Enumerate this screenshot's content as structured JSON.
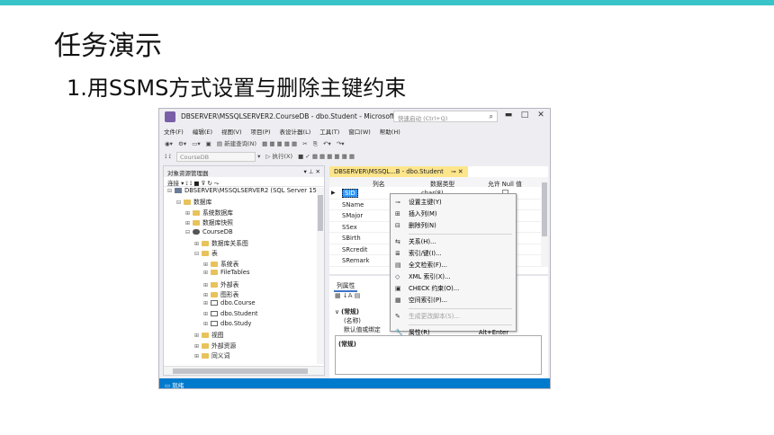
{
  "slide": {
    "title": "任务演示",
    "subtitle": "1.用SSMS方式设置与删除主键约束"
  },
  "window": {
    "title": "DBSERVER\\MSSQLSERVER2.CourseDB - dbo.Student - Microsoft SQL...",
    "quick_launch": "快速启动 (Ctrl+Q)"
  },
  "menu": [
    "文件(F)",
    "编辑(E)",
    "视图(V)",
    "项目(P)",
    "表设计器(L)",
    "工具(T)",
    "窗口(W)",
    "帮助(H)"
  ],
  "toolbar": {
    "new_query": "新建查询(N)",
    "database": "CourseDB",
    "execute": "执行(X)"
  },
  "object_explorer": {
    "title": "对象资源管理器",
    "connect": "连接",
    "tree": [
      {
        "label": "DBSERVER\\MSSQLSERVER2 (SQL Server 15",
        "level": 0,
        "icon": "server-icon",
        "exp": "⊟"
      },
      {
        "label": "数据库",
        "level": 1,
        "icon": "folder-icon",
        "exp": "⊟"
      },
      {
        "label": "系统数据库",
        "level": 2,
        "icon": "folder-icon",
        "exp": "⊞"
      },
      {
        "label": "数据库快照",
        "level": 2,
        "icon": "folder-icon",
        "exp": "⊞"
      },
      {
        "label": "CourseDB",
        "level": 2,
        "icon": "database-icon",
        "exp": "⊟"
      },
      {
        "label": "数据库关系图",
        "level": 3,
        "icon": "folder-icon",
        "exp": "⊞"
      },
      {
        "label": "表",
        "level": 3,
        "icon": "folder-icon",
        "exp": "⊟"
      },
      {
        "label": "系统表",
        "level": 4,
        "icon": "folder-icon",
        "exp": "⊞"
      },
      {
        "label": "FileTables",
        "level": 4,
        "icon": "folder-icon",
        "exp": "⊞"
      },
      {
        "label": "外部表",
        "level": 4,
        "icon": "folder-icon",
        "exp": "⊞"
      },
      {
        "label": "图形表",
        "level": 4,
        "icon": "folder-icon",
        "exp": "⊞"
      },
      {
        "label": "dbo.Course",
        "level": 4,
        "icon": "table-icon",
        "exp": "⊞"
      },
      {
        "label": "dbo.Student",
        "level": 4,
        "icon": "table-icon",
        "exp": "⊞"
      },
      {
        "label": "dbo.Study",
        "level": 4,
        "icon": "table-icon",
        "exp": "⊞"
      },
      {
        "label": "视图",
        "level": 3,
        "icon": "folder-icon",
        "exp": "⊞"
      },
      {
        "label": "外部资源",
        "level": 3,
        "icon": "folder-icon",
        "exp": "⊞"
      },
      {
        "label": "同义词",
        "level": 3,
        "icon": "folder-icon",
        "exp": "⊞"
      }
    ]
  },
  "designer": {
    "tab": "DBSERVER\\MSSQL...B - dbo.Student",
    "headers": {
      "col_name": "列名",
      "data_type": "数据类型",
      "allow_null": "允许 Null 值"
    },
    "rows": [
      {
        "name": "SID",
        "type": "char(8)"
      },
      {
        "name": "SName",
        "type": ""
      },
      {
        "name": "SMajor",
        "type": ""
      },
      {
        "name": "SSex",
        "type": ""
      },
      {
        "name": "SBirth",
        "type": ""
      },
      {
        "name": "SRcredit",
        "type": ""
      },
      {
        "name": "SRemark",
        "type": ""
      }
    ]
  },
  "properties": {
    "tab": "列属性",
    "group": "(常规)",
    "name_label": "(名称)",
    "default_label": "默认值或绑定",
    "desc_title": "(常规)"
  },
  "context_menu": [
    {
      "label": "设置主键(Y)",
      "icon": "key-icon",
      "glyph": "⊸",
      "shortcut": "",
      "disabled": false
    },
    {
      "label": "插入列(M)",
      "icon": "insert-column-icon",
      "glyph": "⊞",
      "shortcut": "",
      "disabled": false
    },
    {
      "label": "删除列(N)",
      "icon": "delete-column-icon",
      "glyph": "⊟",
      "shortcut": "",
      "disabled": false
    },
    {
      "sep": true
    },
    {
      "label": "关系(H)...",
      "icon": "relationship-icon",
      "glyph": "⇆",
      "shortcut": "",
      "disabled": false
    },
    {
      "label": "索引/键(I)...",
      "icon": "index-icon",
      "glyph": "≣",
      "shortcut": "",
      "disabled": false
    },
    {
      "label": "全文检索(F)...",
      "icon": "fulltext-icon",
      "glyph": "▤",
      "shortcut": "",
      "disabled": false
    },
    {
      "label": "XML 索引(X)...",
      "icon": "xml-index-icon",
      "glyph": "◇",
      "shortcut": "",
      "disabled": false
    },
    {
      "label": "CHECK 约束(O)...",
      "icon": "check-constraint-icon",
      "glyph": "▣",
      "shortcut": "",
      "disabled": false
    },
    {
      "label": "空间索引(P)...",
      "icon": "spatial-index-icon",
      "glyph": "▦",
      "shortcut": "",
      "disabled": false
    },
    {
      "sep": true
    },
    {
      "label": "生成更改脚本(S)...",
      "icon": "script-icon",
      "glyph": "✎",
      "shortcut": "",
      "disabled": true
    },
    {
      "sep": true
    },
    {
      "label": "属性(R)",
      "icon": "wrench-icon",
      "glyph": "🔧",
      "shortcut": "Alt+Enter",
      "disabled": false
    }
  ],
  "status": "就绪"
}
